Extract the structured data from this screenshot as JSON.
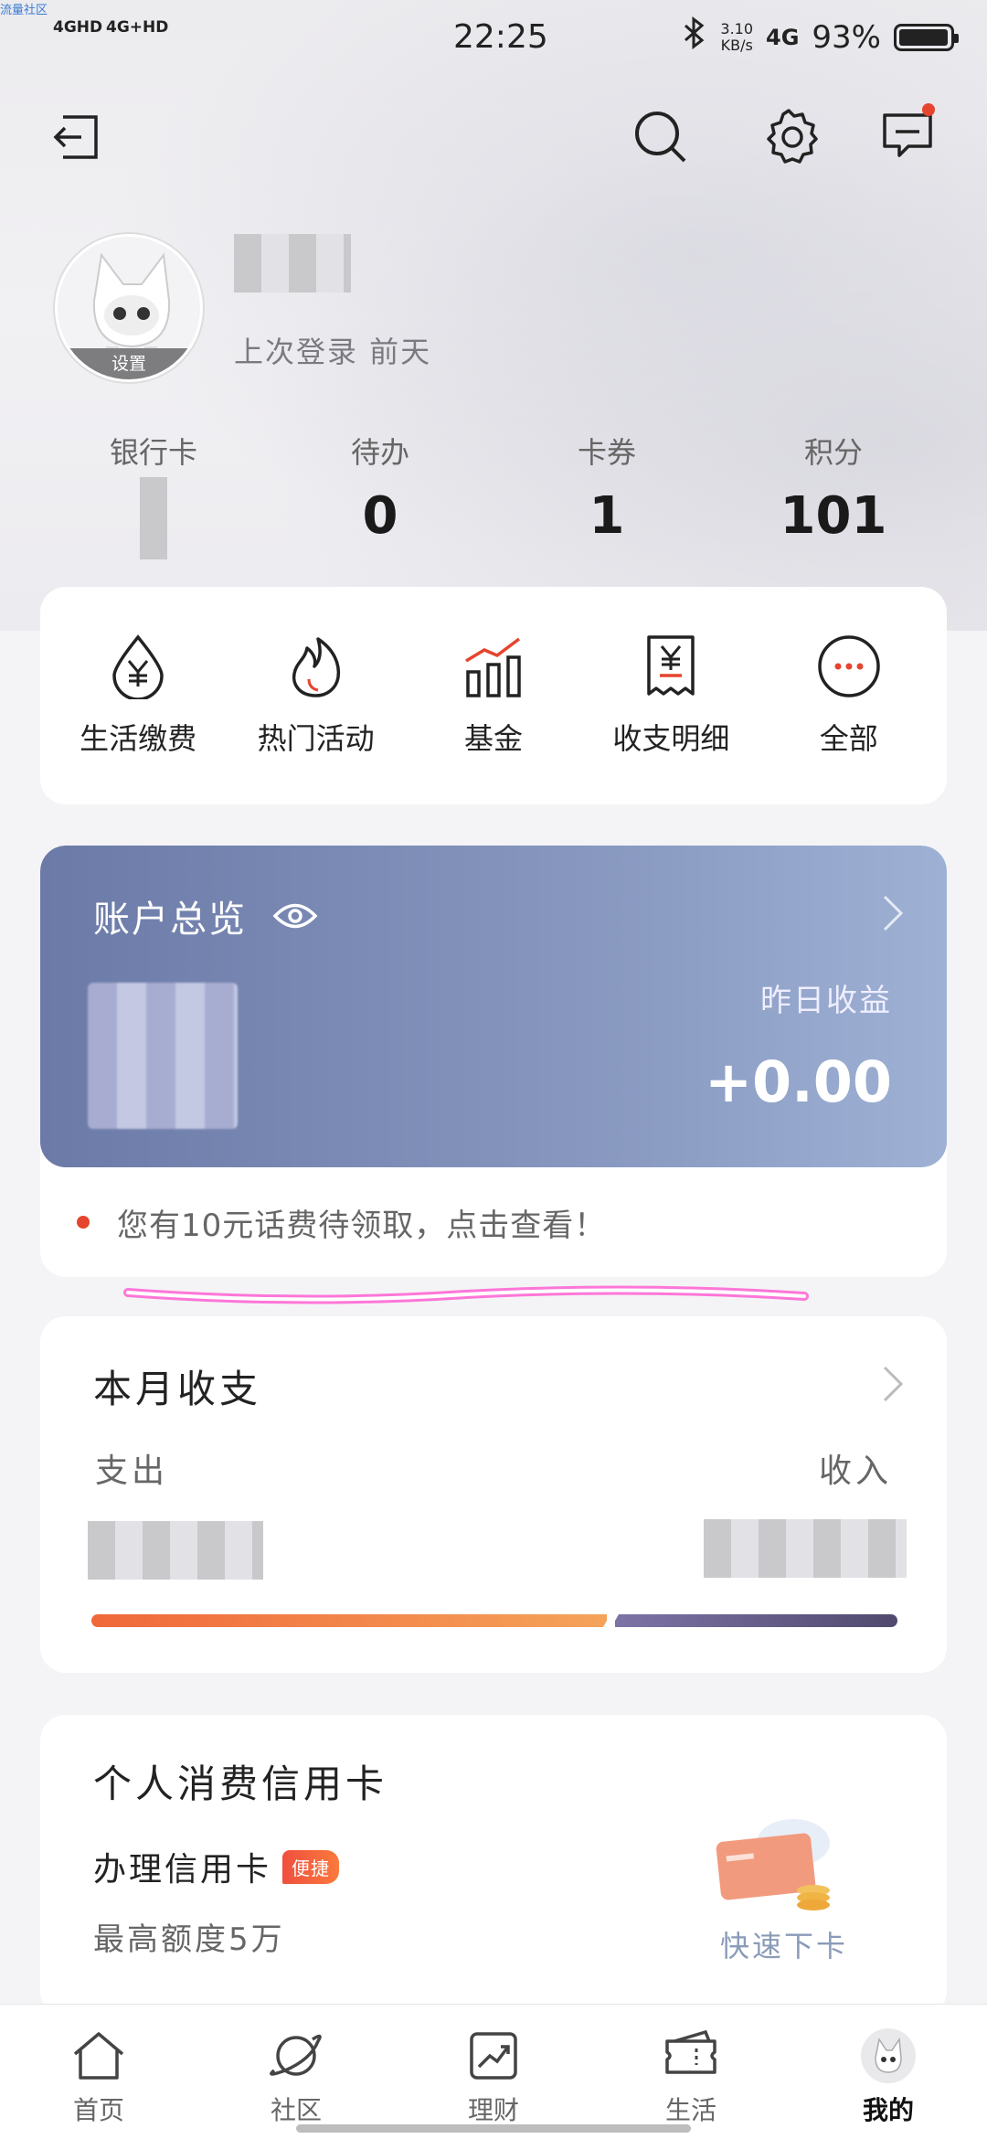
{
  "status_bar": {
    "corner_tag": "流量社区",
    "signal_1": "4GHD",
    "signal_2": "4G+HD",
    "time": "22:25",
    "speed_value": "3.10",
    "speed_unit": "KB/s",
    "network": "4G",
    "battery": "93%"
  },
  "profile": {
    "avatar_label": "设置",
    "last_login": "上次登录 前天"
  },
  "stats": [
    {
      "label": "银行卡",
      "value": ""
    },
    {
      "label": "待办",
      "value": "0"
    },
    {
      "label": "卡券",
      "value": "1"
    },
    {
      "label": "积分",
      "value": "101"
    }
  ],
  "quick_menu": [
    {
      "label": "生活缴费",
      "icon": "utility-payment-icon"
    },
    {
      "label": "热门活动",
      "icon": "flame-icon"
    },
    {
      "label": "基金",
      "icon": "fund-chart-icon"
    },
    {
      "label": "收支明细",
      "icon": "receipt-icon"
    },
    {
      "label": "全部",
      "icon": "more-icon"
    }
  ],
  "account": {
    "title": "账户总览",
    "yesterday_label": "昨日收益",
    "yesterday_value": "+0.00",
    "notice": "您有10元话费待领取，点击查看！"
  },
  "monthly": {
    "title": "本月收支",
    "expense_label": "支出",
    "income_label": "收入"
  },
  "credit_card": {
    "title": "个人消费信用卡",
    "apply_label": "办理信用卡",
    "badge": "便捷",
    "limit": "最高额度5万",
    "action": "快速下卡"
  },
  "bottom_nav": [
    {
      "label": "首页",
      "icon": "home-icon"
    },
    {
      "label": "社区",
      "icon": "planet-icon"
    },
    {
      "label": "理财",
      "icon": "trend-icon"
    },
    {
      "label": "生活",
      "icon": "ticket-icon"
    },
    {
      "label": "我的",
      "icon": "profile-avatar-icon"
    }
  ],
  "colors": {
    "accent_red": "#e5442e",
    "account_card": "#7a89b5"
  }
}
